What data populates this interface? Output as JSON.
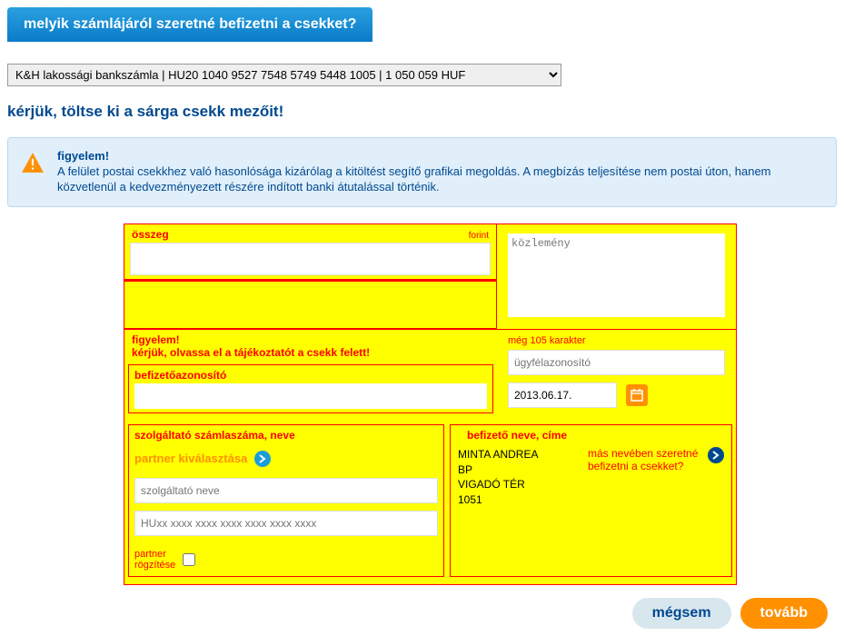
{
  "header": {
    "title": "melyik számlájáról szeretné befizetni a csekket?"
  },
  "account": {
    "selected": "K&H lakossági bankszámla | HU20 1040 9527 7548 5749 5448 1005 | 1 050 059 HUF"
  },
  "section2_title": "kérjük, töltse ki a sárga csekk mezőit!",
  "warning": {
    "title": "figyelem!",
    "text": "A felület postai csekkhez való hasonlósága kizárólag a kitöltést segítő grafikai megoldás. A megbízás teljesítése nem postai úton, hanem közvetlenül a kedvezményezett részére indított banki átutalással történik."
  },
  "check": {
    "amount_label": "összeg",
    "forint_label": "forint",
    "amount_value": "",
    "memo_placeholder": "közlemény",
    "memo_value": "",
    "attention_title": "figyelem!",
    "attention_text": "kérjük, olvassa el a tájékoztatót a csekk felett!",
    "payer_id_label": "befizetőazonosító",
    "payer_id_value": "",
    "char_remain": "még 105 karakter",
    "customer_id_placeholder": "ügyfélazonosító",
    "customer_id_value": "",
    "date_value": "2013.06.17.",
    "provider_title": "szolgáltató számlaszáma, neve",
    "partner_select_label": "partner kiválasztása",
    "provider_name_placeholder": "szolgáltató neve",
    "provider_name_value": "",
    "provider_acct_placeholder": "HUxx xxxx xxxx xxxx xxxx xxxx xxxx",
    "provider_acct_value": "",
    "partner_save_label": "partner\nrögzítése",
    "payer_title": "befizető neve, címe",
    "payer_name": "MINTA ANDREA",
    "payer_city": "BP",
    "payer_street": "VIGADÓ TÉR",
    "payer_zip": "1051",
    "other_name_link": "más nevében szeretné befizetni a csekket?"
  },
  "buttons": {
    "cancel": "mégsem",
    "next": "tovább"
  }
}
